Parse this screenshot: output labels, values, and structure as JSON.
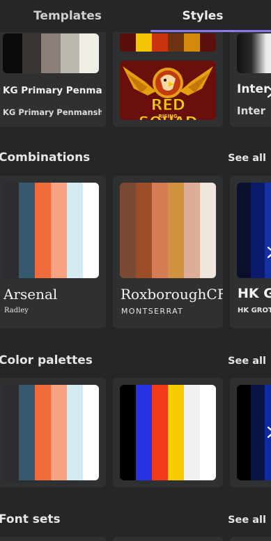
{
  "tabs": [
    {
      "label": "Templates"
    },
    {
      "label": "Styles"
    }
  ],
  "top_row": {
    "card1": {
      "swatches": [
        "#0b0b0b",
        "#3a3433",
        "#8c807b",
        "#bcbaae",
        "#efefe7"
      ],
      "font_primary": "KG Primary Penmanship",
      "font_secondary": "KG Primary Penmanship"
    },
    "card2": {
      "swatches": [
        "#5a0f0a",
        "#f3c400",
        "#c9340f",
        "#6e3412",
        "#d48a0b",
        "#5c120c"
      ],
      "logo_text": "RED SQUAD",
      "logo_subtext": "RISING"
    },
    "card3": {
      "font_primary": "Inter",
      "font_secondary": "Inter"
    }
  },
  "sections": {
    "combinations": {
      "title": "Combinations",
      "see_all": "See all",
      "cards": [
        {
          "swatches": [
            "#2a2c2f",
            "#355a70",
            "#f26b3a",
            "#f9a183",
            "#d4ebf2",
            "#ffffff"
          ],
          "heading": "Arsenal",
          "sub": "Radley"
        },
        {
          "swatches": [
            "#7a4a32",
            "#9c4e28",
            "#d57c54",
            "#d0923f",
            "#dcae96",
            "#efe6de"
          ],
          "heading": "RoxboroughCF",
          "sub": "MONTSERRAT"
        },
        {
          "swatches": [
            "#0b0f2c",
            "#0b1a6a",
            "#1530a0"
          ],
          "heading": "HK Grotesk",
          "sub": "HK GROTESK"
        }
      ]
    },
    "color_palettes": {
      "title": "Color palettes",
      "see_all": "See all",
      "cards": [
        {
          "swatches": [
            "#2a2c2f",
            "#355a70",
            "#f26b3a",
            "#f9a183",
            "#d4ebf2",
            "#ffffff"
          ]
        },
        {
          "swatches": [
            "#000000",
            "#2633e5",
            "#f23a18",
            "#f7cc00",
            "#f1f1f1",
            "#ffffff"
          ]
        },
        {
          "swatches": [
            "#000000",
            "#0a1446",
            "#0f2aa0"
          ]
        }
      ]
    },
    "font_sets": {
      "title": "Font sets",
      "see_all": "See all"
    }
  }
}
